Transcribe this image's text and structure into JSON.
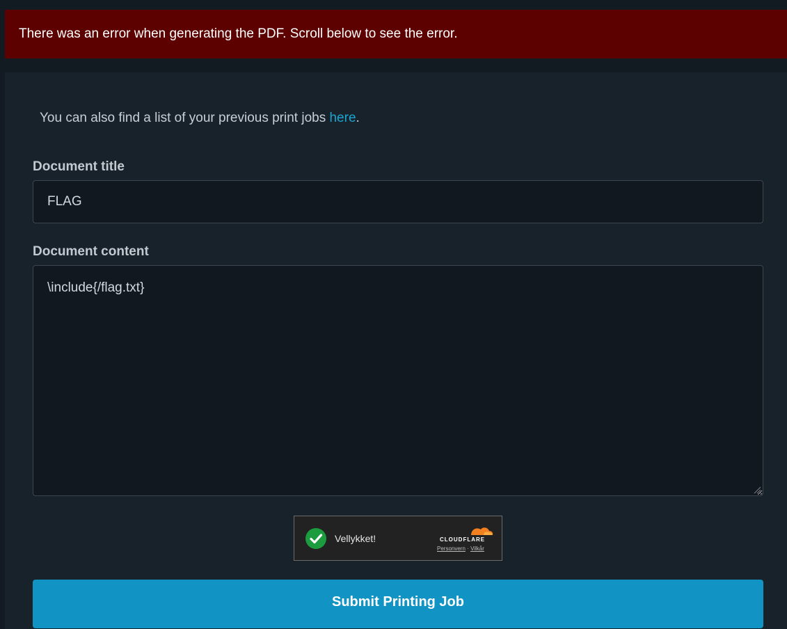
{
  "alert": {
    "message": "There was an error when generating the PDF. Scroll below to see the error."
  },
  "intro": {
    "text_before": "You can also find a list of your previous print jobs ",
    "link_text": "here",
    "text_after": "."
  },
  "form": {
    "title_label": "Document title",
    "title_value": "FLAG",
    "content_label": "Document content",
    "content_value": "\\include{/flag.txt}"
  },
  "captcha": {
    "status": "Vellykket!",
    "brand": "CLOUDFLARE",
    "privacy_link": "Personvern",
    "separator": "·",
    "terms_link": "Vilkår"
  },
  "submit": {
    "label": "Submit Printing Job"
  },
  "colors": {
    "background": "#131b22",
    "alert_background": "#5c0000",
    "link": "#1aa6d2",
    "submit_background": "#1193c3",
    "captcha_success": "#1c9b3f",
    "cloudflare_orange": "#f38020"
  }
}
